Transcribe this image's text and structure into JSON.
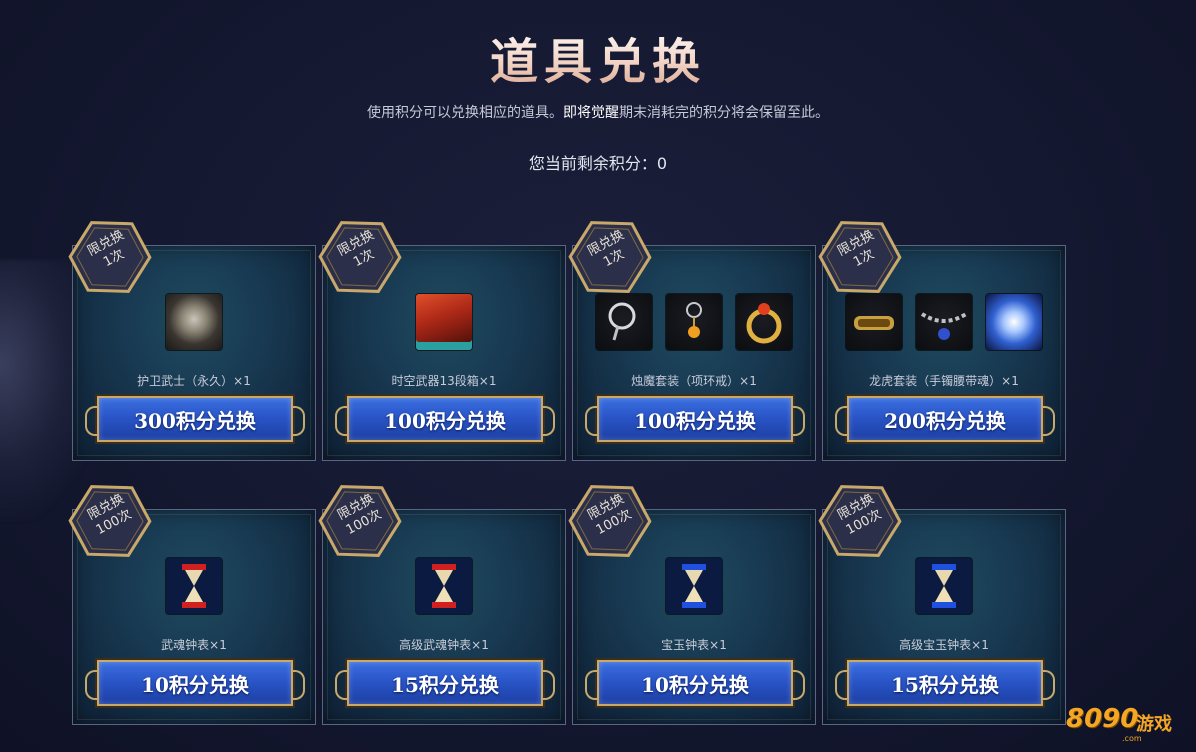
{
  "header": {
    "title": "道具兑换",
    "subtitle_pre": "使用积分可以兑换相应的道具。",
    "subtitle_hl": "即将觉醒",
    "subtitle_post": "期末消耗完的积分将会保留至此。",
    "points_label": "您当前剩余积分：0"
  },
  "cards": [
    {
      "badge_line1": "限兑换",
      "badge_line2": "1次",
      "name": "护卫武士（永久）×1",
      "button": "300积分兑换",
      "icons": [
        "armor-icon"
      ]
    },
    {
      "badge_line1": "限兑换",
      "badge_line2": "1次",
      "name": "时空武器13段箱×1",
      "button": "100积分兑换",
      "icons": [
        "chest-icon"
      ]
    },
    {
      "badge_line1": "限兑换",
      "badge_line2": "1次",
      "name": "烛魔套装（项环戒）×1",
      "button": "100积分兑换",
      "icons": [
        "necklace-icon",
        "earring-icon",
        "ring-icon"
      ]
    },
    {
      "badge_line1": "限兑换",
      "badge_line2": "1次",
      "name": "龙虎套装（手镯腰带魂）×1",
      "button": "200积分兑换",
      "icons": [
        "bracelet-icon",
        "belt-icon",
        "soul-orb-icon"
      ]
    },
    {
      "badge_line1": "限兑换",
      "badge_line2": "100次",
      "name": "武魂钟表×1",
      "button": "10积分兑换",
      "icons": [
        "red-hourglass-icon"
      ]
    },
    {
      "badge_line1": "限兑换",
      "badge_line2": "100次",
      "name": "高级武魂钟表×1",
      "button": "15积分兑换",
      "icons": [
        "red-hourglass-icon"
      ]
    },
    {
      "badge_line1": "限兑换",
      "badge_line2": "100次",
      "name": "宝玉钟表×1",
      "button": "10积分兑换",
      "icons": [
        "blue-hourglass-icon"
      ]
    },
    {
      "badge_line1": "限兑换",
      "badge_line2": "100次",
      "name": "高级宝玉钟表×1",
      "button": "15积分兑换",
      "icons": [
        "blue-hourglass-icon"
      ]
    }
  ],
  "watermark": {
    "number": "8090",
    "text": "游戏",
    "domain": ".com"
  }
}
